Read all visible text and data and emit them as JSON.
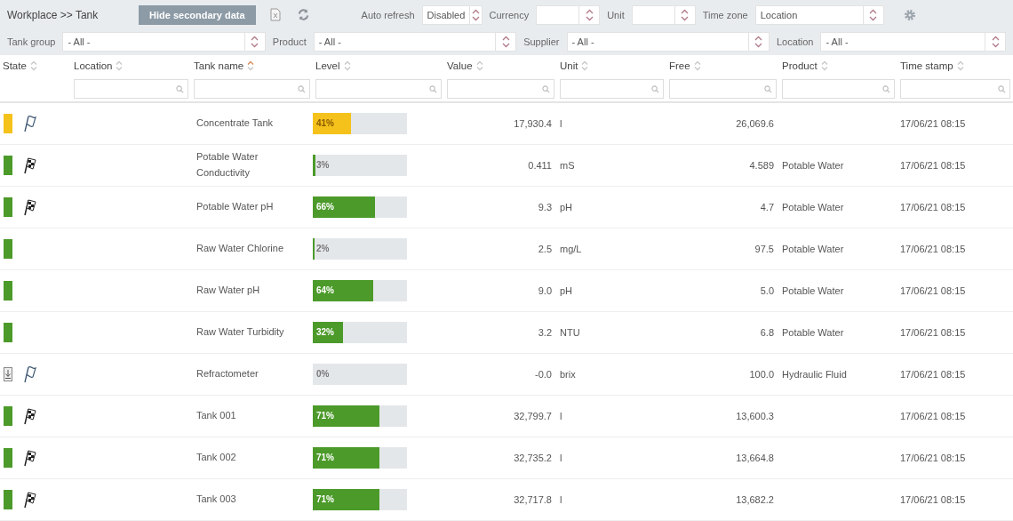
{
  "toolbar": {
    "breadcrumb": "Workplace >> Tank",
    "hide_button": "Hide secondary data",
    "auto_refresh": {
      "label": "Auto refresh",
      "value": "Disabled"
    },
    "currency": {
      "label": "Currency"
    },
    "unit": {
      "label": "Unit"
    },
    "time_zone": {
      "label": "Time zone",
      "value": "Location"
    }
  },
  "filters": [
    {
      "label": "Tank group",
      "value": "- All -"
    },
    {
      "label": "Product",
      "value": "- All -"
    },
    {
      "label": "Supplier",
      "value": "- All -"
    },
    {
      "label": "Location",
      "value": "- All -"
    }
  ],
  "table": {
    "columns": [
      {
        "label": "State",
        "sorted": false,
        "filter": false
      },
      {
        "label": "Location",
        "sorted": false,
        "filter": true
      },
      {
        "label": "Tank name",
        "sorted": true,
        "filter": true
      },
      {
        "label": "Level",
        "sorted": false,
        "filter": true
      },
      {
        "label": "Value",
        "sorted": false,
        "filter": true
      },
      {
        "label": "Unit",
        "sorted": false,
        "filter": true
      },
      {
        "label": "Free",
        "sorted": false,
        "filter": true
      },
      {
        "label": "Product",
        "sorted": false,
        "filter": true
      },
      {
        "label": "Time stamp",
        "sorted": false,
        "filter": true
      }
    ],
    "rows": [
      {
        "state": {
          "kind": "warning"
        },
        "flag": {
          "kind": "outline"
        },
        "name": "Concentrate Tank",
        "level": 0.41,
        "level_text": "41%",
        "value": "17,930.4",
        "unit": "l",
        "free": "26,069.6",
        "time": "17/06/21 08:15"
      },
      {
        "state": {
          "kind": "ok"
        },
        "flag": {
          "kind": "checkered"
        },
        "name": "Potable Water Conductivity",
        "level": 0.03,
        "level_text": "3%",
        "value": "0.411",
        "unit": "mS",
        "free": "4.589",
        "product": "Potable Water",
        "time": "17/06/21 08:15"
      },
      {
        "state": {
          "kind": "ok"
        },
        "flag": {
          "kind": "checkered"
        },
        "name": "Potable Water pH",
        "level": 0.66,
        "level_text": "66%",
        "value": "9.3",
        "unit": "pH",
        "free": "4.7",
        "product": "Potable Water",
        "time": "17/06/21 08:15"
      },
      {
        "state": {
          "kind": "ok"
        },
        "name": "Raw Water Chlorine",
        "level": 0.02,
        "level_text": "2%",
        "value": "2.5",
        "unit": "mg/L",
        "free": "97.5",
        "product": "Potable Water",
        "time": "17/06/21 08:15"
      },
      {
        "state": {
          "kind": "ok"
        },
        "name": "Raw Water pH",
        "level": 0.64,
        "level_text": "64%",
        "value": "9.0",
        "unit": "pH",
        "free": "5.0",
        "product": "Potable Water",
        "time": "17/06/21 08:15"
      },
      {
        "state": {
          "kind": "ok"
        },
        "name": "Raw Water Turbidity",
        "level": 0.32,
        "level_text": "32%",
        "value": "3.2",
        "unit": "NTU",
        "free": "6.8",
        "product": "Potable Water",
        "time": "17/06/21 08:15"
      },
      {
        "state": {
          "kind": "offline"
        },
        "flag": {
          "kind": "outline"
        },
        "name": "Refractometer",
        "level": 0,
        "level_text": "0%",
        "value": "-0.0",
        "unit": "brix",
        "free": "100.0",
        "product": "Hydraulic Fluid",
        "time": "17/06/21 08:15"
      },
      {
        "state": {
          "kind": "ok"
        },
        "flag": {
          "kind": "checkered"
        },
        "name": "Tank 001",
        "level": 0.71,
        "level_text": "71%",
        "value": "32,799.7",
        "unit": "l",
        "free": "13,600.3",
        "time": "17/06/21 08:15"
      },
      {
        "state": {
          "kind": "ok"
        },
        "flag": {
          "kind": "checkered"
        },
        "name": "Tank 002",
        "level": 0.71,
        "level_text": "71%",
        "value": "32,735.2",
        "unit": "l",
        "free": "13,664.8",
        "time": "17/06/21 08:15"
      },
      {
        "state": {
          "kind": "ok"
        },
        "flag": {
          "kind": "checkered"
        },
        "name": "Tank 003",
        "level": 0.71,
        "level_text": "71%",
        "value": "32,717.8",
        "unit": "l",
        "free": "13,682.2",
        "time": "17/06/21 08:15"
      }
    ]
  }
}
